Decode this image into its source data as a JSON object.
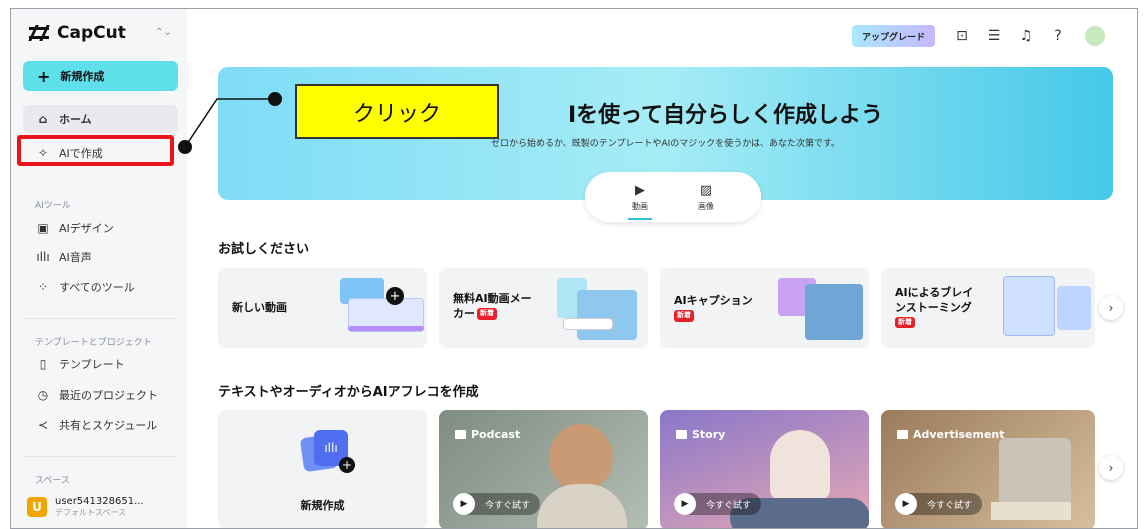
{
  "app": {
    "name": "CapCut"
  },
  "sidebar": {
    "new_button": "新規作成",
    "home": "ホーム",
    "ai_create": "AIで作成",
    "ai_tools_title": "AIツール",
    "ai_tools": [
      "AIデザイン",
      "AI音声",
      "すべてのツール"
    ],
    "templates_title": "テンプレートとプロジェクト",
    "templates": [
      "テンプレート",
      "最近のプロジェクト",
      "共有とスケジュール"
    ],
    "space_title": "スペース",
    "space_user": "user541328651...",
    "space_sub": "デフォルトスペース",
    "space_avatar": "U"
  },
  "topbar": {
    "upgrade": "アップグレード"
  },
  "hero": {
    "title": "Iを使って自分らしく作成しよう",
    "subtitle": "ゼロから始めるか、既製のテンプレートやAIのマジックを使うかは、あなた次第です。",
    "tabs": [
      "動画",
      "画像"
    ]
  },
  "callout": {
    "text": "クリック"
  },
  "try_section": {
    "heading": "お試しください",
    "cards": [
      {
        "line1": "新しい動画",
        "line2": ""
      },
      {
        "line1": "無料AI動画メー",
        "line2": "カー"
      },
      {
        "line1": "AIキャプション",
        "line2": ""
      },
      {
        "line1": "AIによるブレイ",
        "line2": "ンストーミング"
      }
    ],
    "badge": "新着"
  },
  "voice_section": {
    "heading": "テキストやオーディオからAIアフレコを作成",
    "new_label": "新規作成",
    "cards": [
      "Podcast",
      "Story",
      "Advertisement"
    ],
    "try_label": "今すぐ試す"
  },
  "colors": {
    "accent": "#5ee0ea",
    "highlight": "#e8141e",
    "callout": "#ffff00"
  }
}
